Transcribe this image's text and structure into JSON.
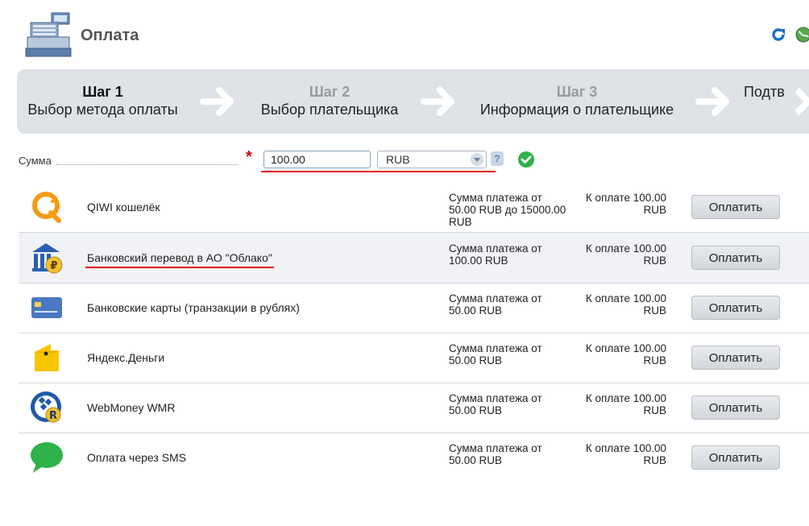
{
  "header": {
    "title": "Оплата"
  },
  "steps": [
    {
      "num": "Шаг 1",
      "title": "Выбор метода оплаты",
      "active": true
    },
    {
      "num": "Шаг 2",
      "title": "Выбор плательщика",
      "active": false
    },
    {
      "num": "Шаг 3",
      "title": "Информация о плательщике",
      "active": false
    },
    {
      "num": "",
      "title": "Подтв",
      "active": false
    }
  ],
  "amount": {
    "label": "Сумма",
    "required_mark": "*",
    "value": "100.00",
    "currency": "RUB",
    "help": "?"
  },
  "methods": [
    {
      "name": "QIWI кошелёк",
      "range": "Сумма платежа от 50.00 RUB до 15000.00 RUB",
      "to_pay": "К оплате 100.00 RUB",
      "button": "Оплатить",
      "icon": "qiwi-icon"
    },
    {
      "name": "Банковский перевод в АО \"Облако\"",
      "range": "Сумма платежа от 100.00 RUB",
      "to_pay": "К оплате 100.00 RUB",
      "button": "Оплатить",
      "icon": "bank-icon"
    },
    {
      "name": "Банковские карты (транзакции в рублях)",
      "range": "Сумма платежа от 50.00 RUB",
      "to_pay": "К оплате 100.00 RUB",
      "button": "Оплатить",
      "icon": "bank-card-icon"
    },
    {
      "name": "Яндекс.Деньги",
      "range": "Сумма платежа от 50.00 RUB",
      "to_pay": "К оплате 100.00 RUB",
      "button": "Оплатить",
      "icon": "yandex-money-icon"
    },
    {
      "name": "WebMoney WMR",
      "range": "Сумма платежа от 50.00 RUB",
      "to_pay": "К оплате 100.00 RUB",
      "button": "Оплатить",
      "icon": "webmoney-icon"
    },
    {
      "name": "Оплата через SMS",
      "range": "Сумма платежа от 50.00 RUB",
      "to_pay": "К оплате 100.00 RUB",
      "button": "Оплатить",
      "icon": "sms-icon"
    }
  ],
  "colors": {
    "accent_underline": "#e00000",
    "steps_bg": "#dfe3e8",
    "check": "#2db34a"
  }
}
